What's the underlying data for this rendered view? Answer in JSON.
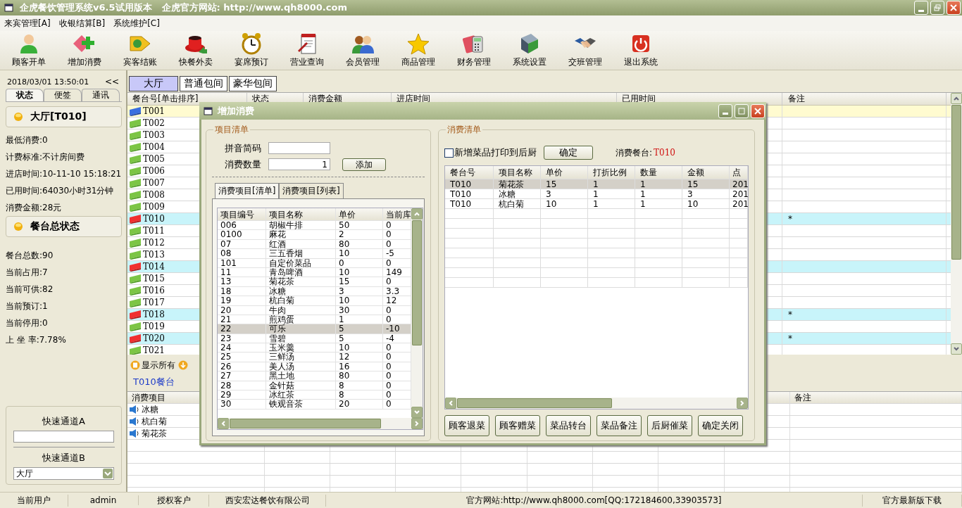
{
  "window": {
    "title": "企虎餐饮管理系统v6.5试用版本",
    "site": "企虎官方网站: http://www.qh8000.com"
  },
  "menu": [
    "来宾管理[A]",
    "收银结算[B]",
    "系统维护[C]"
  ],
  "toolbar": [
    "顾客开单",
    "增加消费",
    "宾客结账",
    "快餐外卖",
    "宴席预订",
    "营业查询",
    "会员管理",
    "商品管理",
    "财务管理",
    "系统设置",
    "交班管理",
    "退出系统"
  ],
  "sidebar": {
    "datetime": "2018/03/01 13:50:01",
    "collapse": "<<",
    "tabs": [
      {
        "label": "状态",
        "selected": true
      },
      {
        "label": "便签",
        "selected": false
      },
      {
        "label": "通讯",
        "selected": false
      }
    ],
    "sections": [
      {
        "title": "大厅[T010]",
        "lines": [
          {
            "label": "最低消费:",
            "value": "0"
          },
          {
            "label": "计费标准:",
            "value": "不计房间费"
          },
          {
            "label": "进店时间:",
            "value": "10-11-10 15:18:21"
          },
          {
            "label": "已用时间:",
            "value": "64030小时31分钟"
          },
          {
            "label": "消费金额:",
            "value": "28元"
          }
        ]
      },
      {
        "title": "餐台总状态",
        "lines": [
          {
            "label": "餐台总数:",
            "value": "90"
          },
          {
            "label": "当前占用:",
            "value": "7"
          },
          {
            "label": "当前可供:",
            "value": "82"
          },
          {
            "label": "当前预订:",
            "value": "1"
          },
          {
            "label": "当前停用:",
            "value": "0"
          },
          {
            "label": "上 坐 率:",
            "value": "7.78%"
          }
        ]
      }
    ],
    "quick_a": {
      "label": "快速通道A"
    },
    "quick_b": {
      "label": "快速通道B",
      "value": "大厅"
    }
  },
  "hall_tabs": [
    {
      "label": "大厅",
      "selected": true
    },
    {
      "label": "普通包间",
      "selected": false
    },
    {
      "label": "豪华包间",
      "selected": false
    }
  ],
  "tables": {
    "columns": [
      "餐台号[单击排序]",
      "状态",
      "消费金额",
      "进店时间",
      "已用时间",
      "备注"
    ],
    "rows": [
      {
        "table": "T001",
        "kind": "reserved",
        "selected": true
      },
      {
        "table": "T002",
        "kind": "free",
        "selected": false
      },
      {
        "table": "T003",
        "kind": "free",
        "selected": false
      },
      {
        "table": "T004",
        "kind": "free",
        "selected": false
      },
      {
        "table": "T005",
        "kind": "free",
        "selected": false
      },
      {
        "table": "T006",
        "kind": "free",
        "selected": false
      },
      {
        "table": "T007",
        "kind": "free",
        "selected": false
      },
      {
        "table": "T008",
        "kind": "free",
        "selected": false
      },
      {
        "table": "T009",
        "kind": "free",
        "selected": false
      },
      {
        "table": "T010",
        "kind": "occupied",
        "selected": false,
        "note": "*"
      },
      {
        "table": "T011",
        "kind": "free",
        "selected": false
      },
      {
        "table": "T012",
        "kind": "free",
        "selected": false
      },
      {
        "table": "T013",
        "kind": "free",
        "selected": false
      },
      {
        "table": "T014",
        "kind": "occupied",
        "selected": false
      },
      {
        "table": "T015",
        "kind": "free",
        "selected": false
      },
      {
        "table": "T016",
        "kind": "free",
        "selected": false
      },
      {
        "table": "T017",
        "kind": "free",
        "selected": false
      },
      {
        "table": "T018",
        "kind": "occupied",
        "selected": false,
        "note": "*"
      },
      {
        "table": "T019",
        "kind": "free",
        "selected": false
      },
      {
        "table": "T020",
        "kind": "occupied",
        "selected": false,
        "note": "*"
      },
      {
        "table": "T021",
        "kind": "free",
        "selected": false
      }
    ]
  },
  "detail": {
    "show_all": "显示所有",
    "tab": "T010餐台",
    "columns": [
      "消费项目",
      "备注"
    ],
    "rows": [
      "冰糖",
      "杭白菊",
      "菊花茶"
    ]
  },
  "dialog": {
    "title": "增加消费",
    "left": {
      "legend": "项目清单",
      "fields": [
        {
          "label": "拼音简码"
        },
        {
          "label": "消费数量",
          "value": "1"
        }
      ],
      "add": "添加",
      "tabs": [
        {
          "label": "消费项目[清单]",
          "selected": true
        },
        {
          "label": "消费项目[列表]",
          "selected": false
        }
      ],
      "columns": [
        "项目编号",
        "项目名称",
        "单价",
        "当前库"
      ],
      "rows": [
        {
          "cells": [
            "006",
            "胡椒牛排",
            "50",
            "0"
          ],
          "selected": false
        },
        {
          "cells": [
            "0100",
            "麻花",
            "2",
            "0"
          ],
          "selected": false
        },
        {
          "cells": [
            "07",
            "红酒",
            "80",
            "0"
          ],
          "selected": false
        },
        {
          "cells": [
            "08",
            "三五香烟",
            "10",
            "-5"
          ],
          "selected": false
        },
        {
          "cells": [
            "101",
            "自定价菜品",
            "0",
            "0"
          ],
          "selected": false
        },
        {
          "cells": [
            "11",
            "青岛啤酒",
            "10",
            "149"
          ],
          "selected": false
        },
        {
          "cells": [
            "13",
            "菊花茶",
            "15",
            "0"
          ],
          "selected": false
        },
        {
          "cells": [
            "18",
            "冰糖",
            "3",
            "3.3"
          ],
          "selected": false
        },
        {
          "cells": [
            "19",
            "杭白菊",
            "10",
            "12"
          ],
          "selected": false
        },
        {
          "cells": [
            "20",
            "牛肉",
            "30",
            "0"
          ],
          "selected": false
        },
        {
          "cells": [
            "21",
            "煎鸡蛋",
            "1",
            "0"
          ],
          "selected": false
        },
        {
          "cells": [
            "22",
            "可乐",
            "5",
            "-10"
          ],
          "selected": true
        },
        {
          "cells": [
            "23",
            "雪碧",
            "5",
            "-4"
          ],
          "selected": false
        },
        {
          "cells": [
            "24",
            "玉米羹",
            "10",
            "0"
          ],
          "selected": false
        },
        {
          "cells": [
            "25",
            "三鲜汤",
            "12",
            "0"
          ],
          "selected": false
        },
        {
          "cells": [
            "26",
            "美人汤",
            "16",
            "0"
          ],
          "selected": false
        },
        {
          "cells": [
            "27",
            "黑土地",
            "80",
            "0"
          ],
          "selected": false
        },
        {
          "cells": [
            "28",
            "金针菇",
            "8",
            "0"
          ],
          "selected": false
        },
        {
          "cells": [
            "29",
            "冰红茶",
            "8",
            "0"
          ],
          "selected": false
        },
        {
          "cells": [
            "30",
            "铁观音茶",
            "20",
            "0"
          ],
          "selected": false
        }
      ]
    },
    "right": {
      "legend": "消费清单",
      "checkbox": {
        "label": "新增菜品打印到后厨",
        "checked": false
      },
      "confirm": "确定",
      "table_label": "消费餐台:",
      "table_value": "T010",
      "columns": [
        "餐台号",
        "项目名称",
        "单价",
        "打折比例",
        "数量",
        "金额",
        "点"
      ],
      "rows": [
        {
          "cells": [
            "T010",
            "菊花茶",
            "15",
            "1",
            "1",
            "15",
            "201"
          ],
          "selected": true
        },
        {
          "cells": [
            "T010",
            "冰糖",
            "3",
            "1",
            "1",
            "3",
            "201"
          ],
          "selected": false
        },
        {
          "cells": [
            "T010",
            "杭白菊",
            "10",
            "1",
            "1",
            "10",
            "201"
          ],
          "selected": false
        }
      ],
      "buttons": [
        "顾客退菜",
        "顾客赠菜",
        "菜品转台",
        "菜品备注",
        "后厨催菜",
        "确定关闭"
      ]
    }
  },
  "status_bar": [
    "当前用户",
    "admin",
    "授权客户",
    "西安宏达餐饮有限公司",
    "官方网站:http://www.qh8000.com[QQ:172184600,33903573]",
    "官方最新版下载"
  ]
}
